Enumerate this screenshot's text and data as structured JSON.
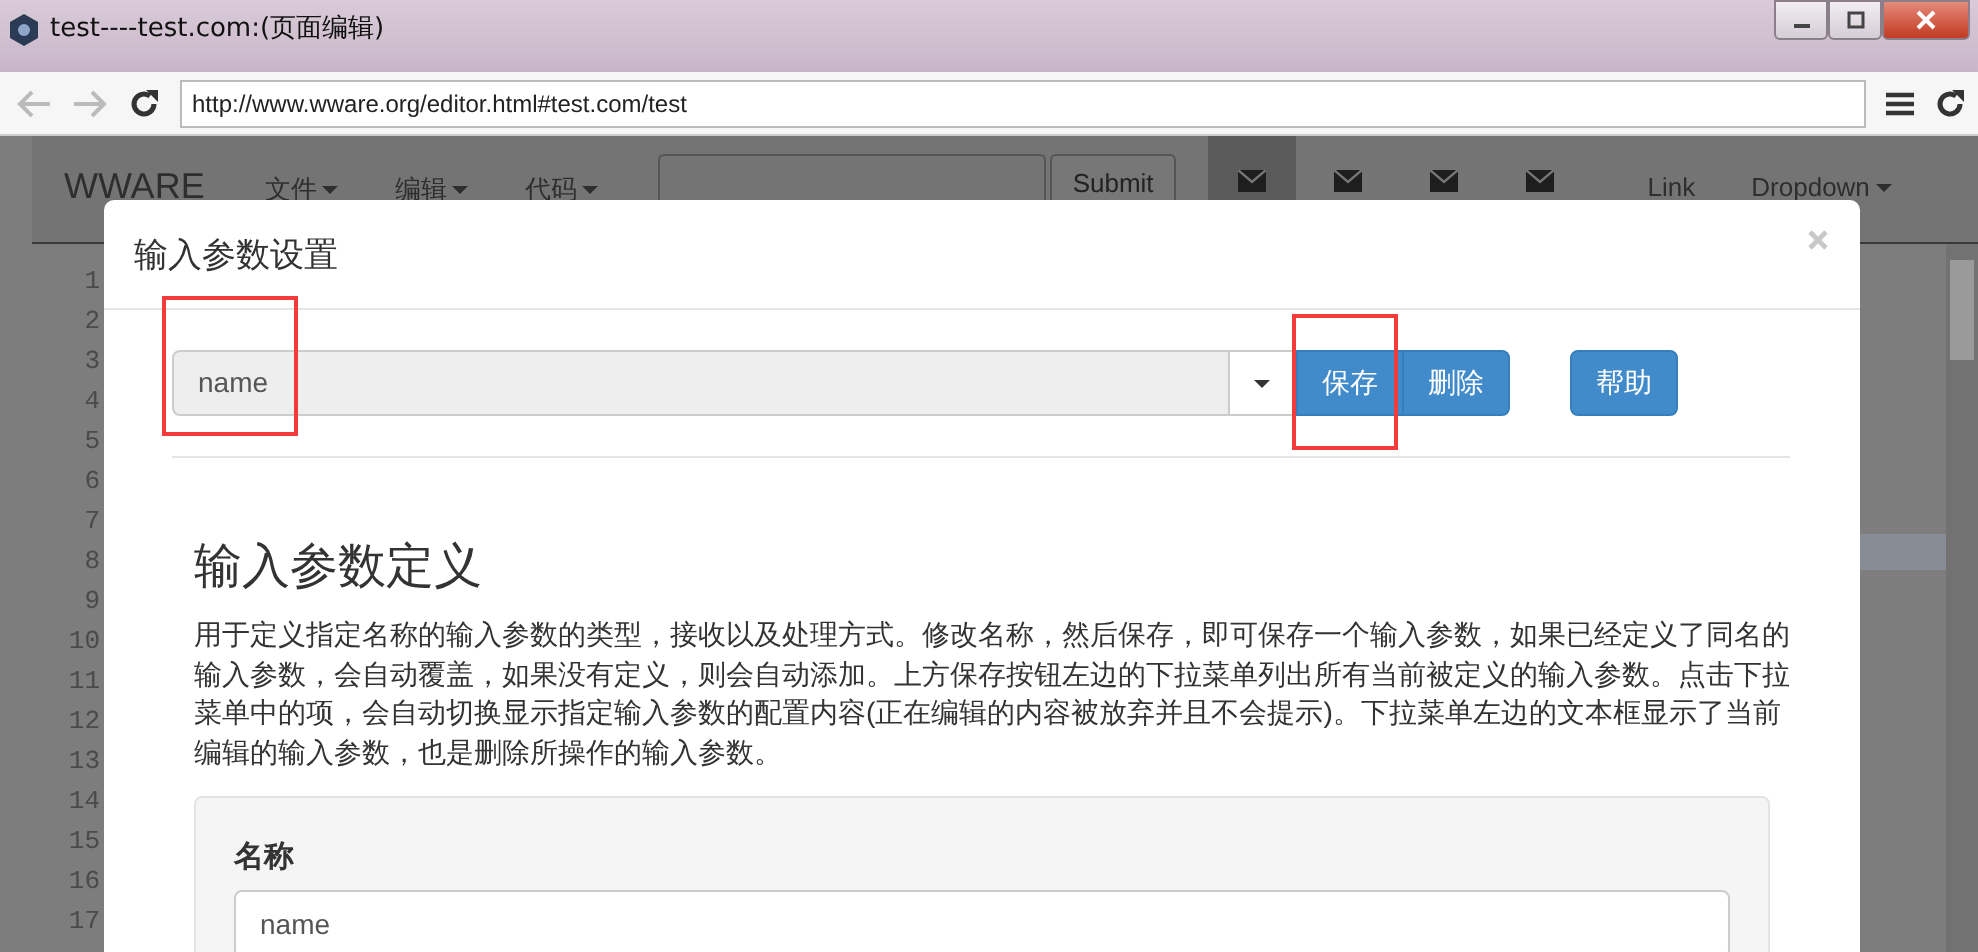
{
  "window": {
    "title": "test----test.com:(页面编辑)"
  },
  "browser": {
    "url": "http://www.wware.org/editor.html#test.com/test"
  },
  "navbar": {
    "brand": "WWARE",
    "menus": [
      {
        "label": "文件"
      },
      {
        "label": "编辑"
      },
      {
        "label": "代码"
      }
    ],
    "submit": "Submit",
    "icon_buttons": [
      {
        "selected": true
      },
      {
        "selected": false
      },
      {
        "selected": false
      },
      {
        "selected": false
      }
    ],
    "link": "Link",
    "dropdown": "Dropdown"
  },
  "editor": {
    "line_numbers": [
      "1",
      "2",
      "3",
      "4",
      "5",
      "6",
      "7",
      "8",
      "9",
      "10",
      "11",
      "12",
      "13",
      "14",
      "15",
      "16",
      "17"
    ]
  },
  "dialog": {
    "title": "输入参数设置",
    "selector": {
      "value": "name",
      "highlighted": true
    },
    "buttons": [
      {
        "label": "保存",
        "highlighted": true
      },
      {
        "label": "删除",
        "highlighted": false
      },
      {
        "label": "帮助",
        "highlighted": false
      }
    ],
    "heading": "输入参数定义",
    "description": "用于定义指定名称的输入参数的类型，接收以及处理方式。修改名称，然后保存，即可保存一个输入参数，如果已经定义了同名的输入参数，会自动覆盖，如果没有定义，则会自动添加。上方保存按钮左边的下拉菜单列出所有当前被定义的输入参数。点击下拉菜单中的项，会自动切换显示指定输入参数的配置内容(正在编辑的内容被放弃并且不会提示)。下拉菜单左边的文本框显示了当前编辑的输入参数，也是删除所操作的输入参数。",
    "form": {
      "label": "名称",
      "value": "name"
    }
  }
}
